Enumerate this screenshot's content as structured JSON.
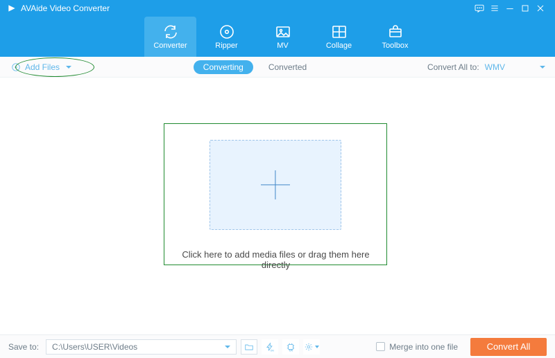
{
  "title": "AVAide Video Converter",
  "tabs": {
    "converter": "Converter",
    "ripper": "Ripper",
    "mv": "MV",
    "collage": "Collage",
    "toolbox": "Toolbox"
  },
  "subbar": {
    "add_files": "Add Files",
    "converting": "Converting",
    "converted": "Converted",
    "convert_all_to_label": "Convert All to:",
    "convert_all_to_value": "WMV"
  },
  "main": {
    "instruction": "Click here to add media files or drag them here directly"
  },
  "bottom": {
    "save_to_label": "Save to:",
    "save_to_path": "C:\\Users\\USER\\Videos",
    "merge_label": "Merge into one file",
    "convert_all": "Convert All"
  }
}
